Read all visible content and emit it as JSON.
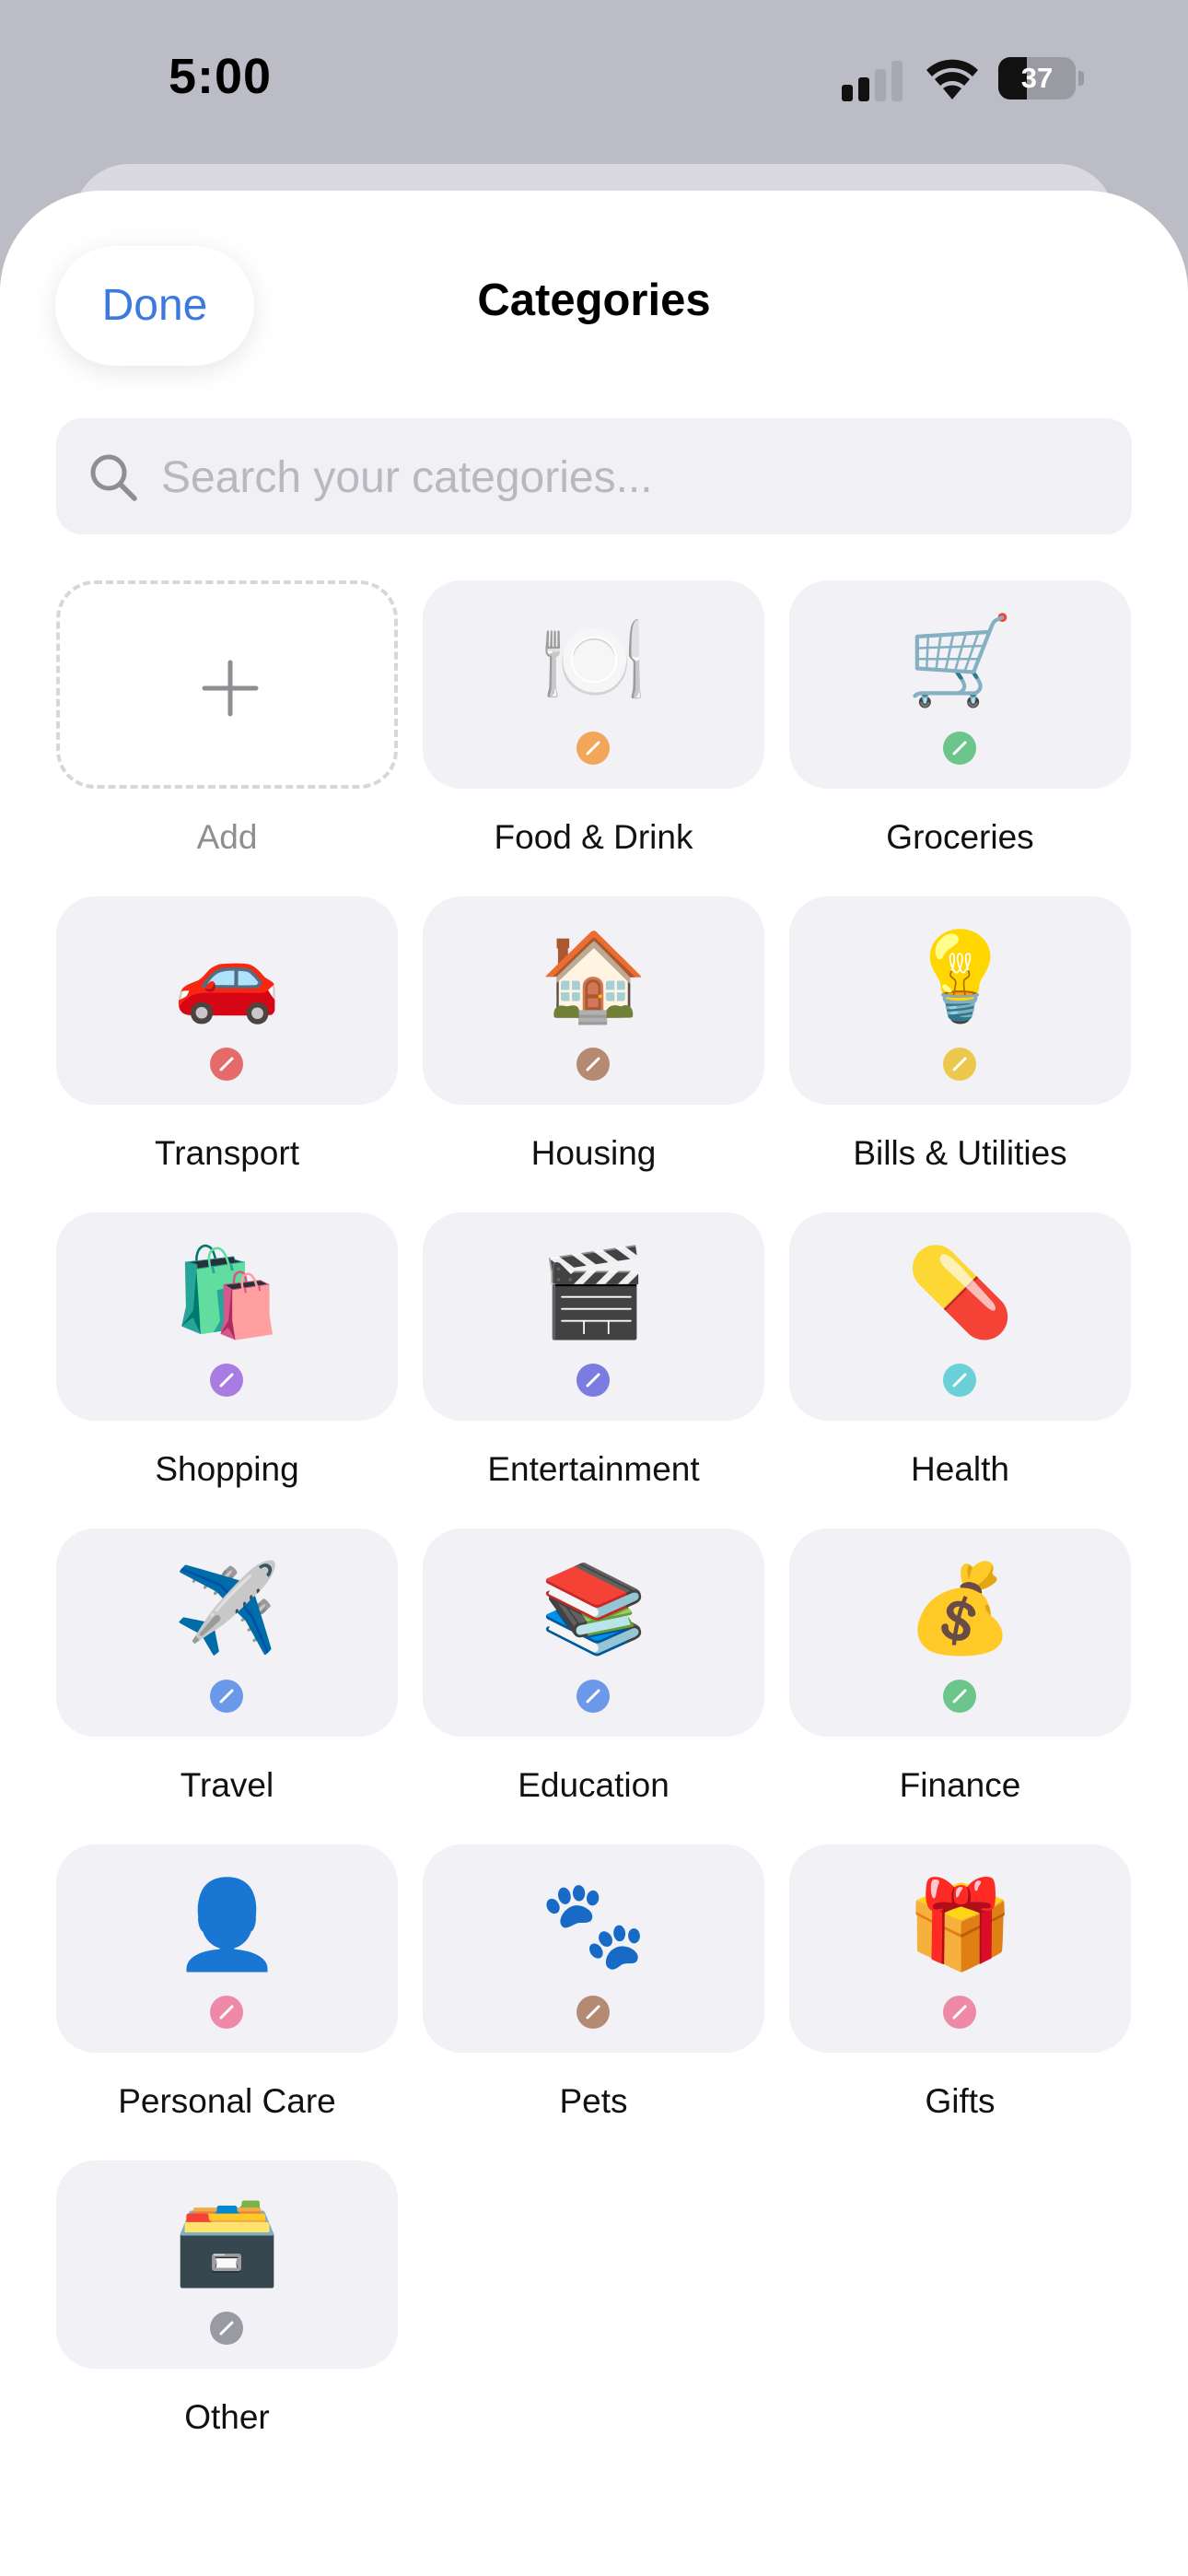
{
  "status_bar": {
    "time": "5:00",
    "battery": "37",
    "battery_level": 0.37
  },
  "header": {
    "done_label": "Done",
    "title": "Categories"
  },
  "search": {
    "placeholder": "Search your categories..."
  },
  "add_tile": {
    "label": "Add"
  },
  "categories": [
    {
      "label": "Food & Drink",
      "emoji": "🍽️",
      "color": "#f2a65a",
      "icon": "plate-fork-knife-icon"
    },
    {
      "label": "Groceries",
      "emoji": "🛒",
      "color": "#6cc58a",
      "icon": "shopping-cart-icon"
    },
    {
      "label": "Transport",
      "emoji": "🚗",
      "color": "#e56b6b",
      "icon": "car-icon"
    },
    {
      "label": "Housing",
      "emoji": "🏠",
      "color": "#b58a73",
      "icon": "house-icon"
    },
    {
      "label": "Bills & Utilities",
      "emoji": "💡",
      "color": "#ecc84d",
      "icon": "light-bulb-icon"
    },
    {
      "label": "Shopping",
      "emoji": "🛍️",
      "color": "#a87ce0",
      "icon": "shopping-bags-icon"
    },
    {
      "label": "Entertainment",
      "emoji": "🎬",
      "color": "#7a7ce0",
      "icon": "clapper-board-icon"
    },
    {
      "label": "Health",
      "emoji": "💊",
      "color": "#6cd0d8",
      "icon": "pill-icon"
    },
    {
      "label": "Travel",
      "emoji": "✈️",
      "color": "#6b98e8",
      "icon": "airplane-icon"
    },
    {
      "label": "Education",
      "emoji": "📚",
      "color": "#6b98e8",
      "icon": "books-icon"
    },
    {
      "label": "Finance",
      "emoji": "💰",
      "color": "#6cc58a",
      "icon": "money-bag-icon"
    },
    {
      "label": "Personal Care",
      "emoji": "👤",
      "color": "#ee8aa8",
      "icon": "person-silhouette-icon"
    },
    {
      "label": "Pets",
      "emoji": "🐾",
      "color": "#b58a73",
      "icon": "paw-prints-icon"
    },
    {
      "label": "Gifts",
      "emoji": "🎁",
      "color": "#ee8aa8",
      "icon": "gift-icon"
    },
    {
      "label": "Other",
      "emoji": "🗃️",
      "color": "#9a9aa2",
      "icon": "card-file-box-icon"
    }
  ]
}
